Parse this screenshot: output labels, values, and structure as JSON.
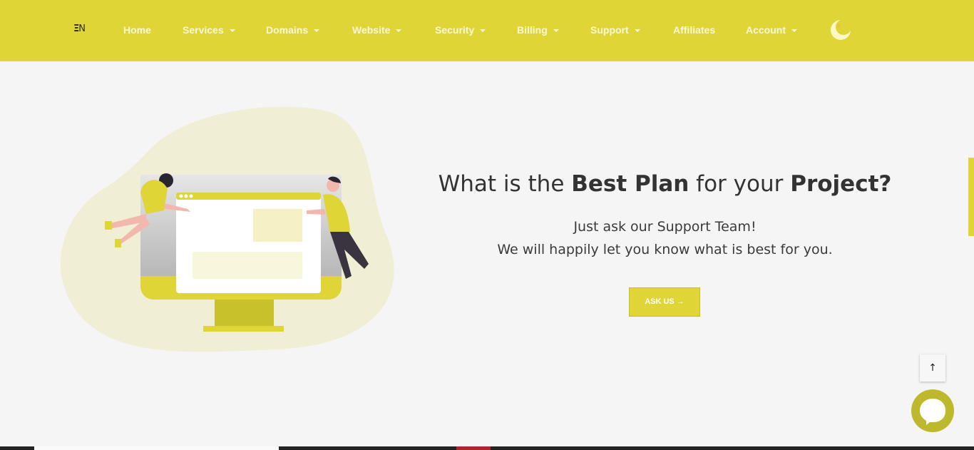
{
  "nav": {
    "logo": {
      "mark": "Ξ",
      "letter": "N"
    },
    "items": [
      {
        "label": "Home",
        "dropdown": false
      },
      {
        "label": "Services",
        "dropdown": true
      },
      {
        "label": "Domains",
        "dropdown": true
      },
      {
        "label": "Website",
        "dropdown": true
      },
      {
        "label": "Security",
        "dropdown": true
      },
      {
        "label": "Billing",
        "dropdown": true
      },
      {
        "label": "Support",
        "dropdown": true
      },
      {
        "label": "Affiliates",
        "dropdown": false
      },
      {
        "label": "Account",
        "dropdown": true
      }
    ],
    "theme_toggle_icon": "moon-icon"
  },
  "hero": {
    "headline": {
      "part1": "What is the ",
      "bold1": "Best Plan",
      "part2": " for your ",
      "bold2": "Project?"
    },
    "sub_line1": "Just ask our Support Team!",
    "sub_line2": "We will happily let you know what is best for you.",
    "button_label": "ASK US →"
  },
  "floating": {
    "back_to_top_icon": "arrow-up-icon",
    "back_to_top_label": "↑",
    "chat_icon": "chat-bubble-icon"
  },
  "colors": {
    "brand": "#dfd536",
    "background": "#f5f5f5",
    "chat": "#beb82c"
  }
}
